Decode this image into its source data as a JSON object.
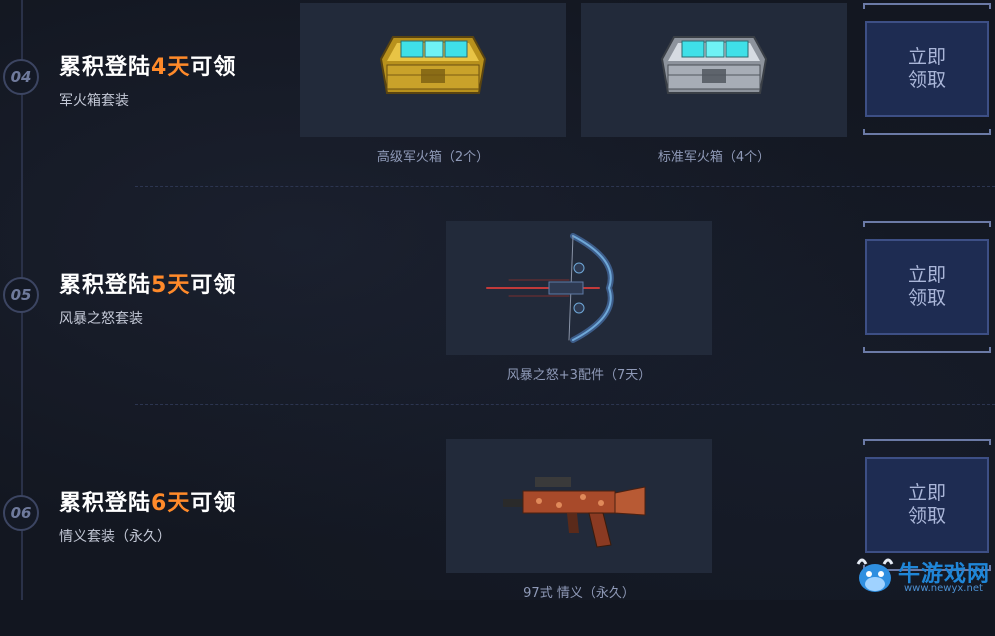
{
  "rows": [
    {
      "num": "04",
      "title_prefix": "累积登陆",
      "title_day": "4天",
      "title_suffix": "可领",
      "subtitle": "军火箱套装",
      "items": [
        {
          "icon": "gold-crate-icon",
          "caption": "高级军火箱（2个）"
        },
        {
          "icon": "silver-crate-icon",
          "caption": "标准军火箱（4个）"
        }
      ],
      "claim_line1": "立即",
      "claim_line2": "领取"
    },
    {
      "num": "05",
      "title_prefix": "累积登陆",
      "title_day": "5天",
      "title_suffix": "可领",
      "subtitle": "风暴之怒套装",
      "items": [
        {
          "icon": "crossbow-icon",
          "caption": "风暴之怒+3配件（7天）"
        }
      ],
      "claim_line1": "立即",
      "claim_line2": "领取"
    },
    {
      "num": "06",
      "title_prefix": "累积登陆",
      "title_day": "6天",
      "title_suffix": "可领",
      "subtitle": "情义套装（永久）",
      "items": [
        {
          "icon": "rifle-icon",
          "caption": "97式 情义（永久）"
        }
      ],
      "claim_line1": "立即",
      "claim_line2": "领取"
    }
  ],
  "watermark": {
    "text": "牛游戏网",
    "url": "www.newyx.net"
  },
  "colors": {
    "accent_day": "#ff8a2a",
    "claim_bg": "#1e2c52",
    "watermark": "#1f86d8"
  }
}
